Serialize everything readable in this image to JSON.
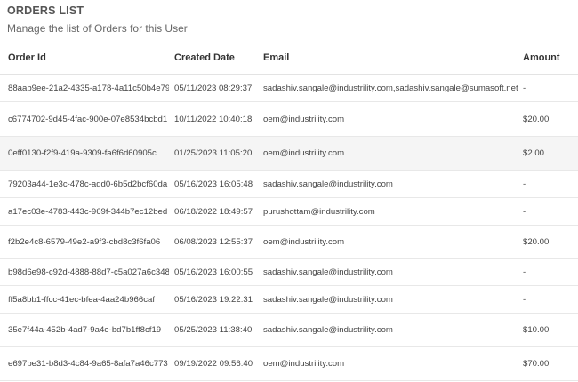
{
  "header": {
    "title": "ORDERS LIST",
    "subtitle": "Manage the list of Orders for this User"
  },
  "table": {
    "columns": [
      "Order Id",
      "Created Date",
      "Email",
      "Amount"
    ],
    "rows": [
      {
        "order_id": "88aab9ee-21a2-4335-a178-4a11c50b4e79",
        "created": "05/11/2023 08:29:37",
        "email": "sadashiv.sangale@industrility.com,sadashiv.sangale@sumasoft.net",
        "amount": "-"
      },
      {
        "order_id": "c6774702-9d45-4fac-900e-07e8534bcbd1",
        "created": "10/11/2022 10:40:18",
        "email": "oem@industrility.com",
        "amount": "$20.00"
      },
      {
        "order_id": "0eff0130-f2f9-419a-9309-fa6f6d60905c",
        "created": "01/25/2023 11:05:20",
        "email": "oem@industrility.com",
        "amount": "$2.00"
      },
      {
        "order_id": "79203a44-1e3c-478c-add0-6b5d2bcf60da",
        "created": "05/16/2023 16:05:48",
        "email": "sadashiv.sangale@industrility.com",
        "amount": "-"
      },
      {
        "order_id": "a17ec03e-4783-443c-969f-344b7ec12bed",
        "created": "06/18/2022 18:49:57",
        "email": "purushottam@industrility.com",
        "amount": "-"
      },
      {
        "order_id": "f2b2e4c8-6579-49e2-a9f3-cbd8c3f6fa06",
        "created": "06/08/2023 12:55:37",
        "email": "oem@industrility.com",
        "amount": "$20.00"
      },
      {
        "order_id": "b98d6e98-c92d-4888-88d7-c5a027a6c348",
        "created": "05/16/2023 16:00:55",
        "email": "sadashiv.sangale@industrility.com",
        "amount": "-"
      },
      {
        "order_id": "ff5a8bb1-ffcc-41ec-bfea-4aa24b966caf",
        "created": "05/16/2023 19:22:31",
        "email": "sadashiv.sangale@industrility.com",
        "amount": "-"
      },
      {
        "order_id": "35e7f44a-452b-4ad7-9a4e-bd7b1ff8cf19",
        "created": "05/25/2023 11:38:40",
        "email": "sadashiv.sangale@industrility.com",
        "amount": "$10.00"
      },
      {
        "order_id": "e697be31-b8d3-4c84-9a65-8afa7a46c773",
        "created": "09/19/2022 09:56:40",
        "email": "oem@industrility.com",
        "amount": "$70.00"
      }
    ]
  }
}
